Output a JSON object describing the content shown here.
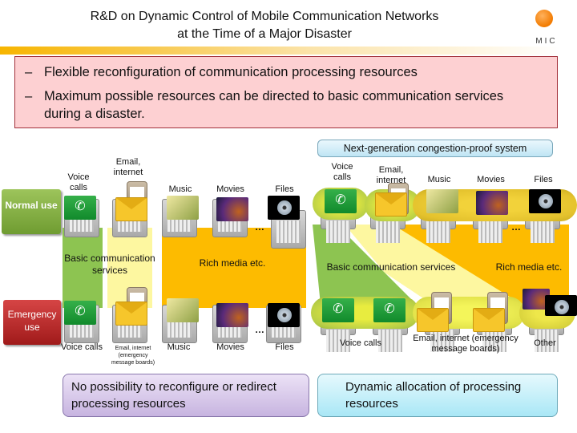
{
  "header": {
    "title_line1": "R&D on Dynamic Control of Mobile Communication Networks",
    "title_line2": "at the Time of a Major Disaster",
    "logo_text": "MIC"
  },
  "summary": {
    "bullet_symbol": "–",
    "bullets": [
      "Flexible reconfiguration of communication processing resources",
      "Maximum possible resources can be directed to basic communication services during a disaster."
    ]
  },
  "modes": {
    "normal": "Normal use",
    "emergency": "Emergency use"
  },
  "current_system": {
    "normal_services": {
      "voice": "Voice calls",
      "email": "Email, internet",
      "music": "Music",
      "movies": "Movies",
      "files": "Files",
      "ellipsis": "…"
    },
    "groups": {
      "basic": "Basic communication services",
      "rich": "Rich media etc."
    },
    "emergency_services": {
      "voice": "Voice calls",
      "email": "Email, internet (emergency message boards)",
      "music": "Music",
      "movies": "Movies",
      "files": "Files",
      "ellipsis": "…"
    },
    "conclusion": "No possibility to reconfigure or redirect processing resources"
  },
  "next_gen_system": {
    "title": "Next-generation congestion-proof system",
    "normal_services": {
      "voice": "Voice calls",
      "email": "Email, internet",
      "music": "Music",
      "movies": "Movies",
      "files": "Files",
      "ellipsis": "…"
    },
    "groups": {
      "basic": "Basic communication services",
      "rich": "Rich media etc."
    },
    "emergency_services": {
      "voice": "Voice calls",
      "email": "Email, internet (emergency message boards)",
      "other": "Other"
    },
    "conclusion": "Dynamic allocation of processing resources"
  },
  "colors": {
    "basic_voice": "#8dc451",
    "basic_email": "#fdf7a0",
    "rich_media": "#fdbb00",
    "normal_button": "#7fab3e",
    "emergency_button": "#c02828",
    "summary_bg": "#fdd0d2",
    "summary_border": "#a2303a"
  }
}
